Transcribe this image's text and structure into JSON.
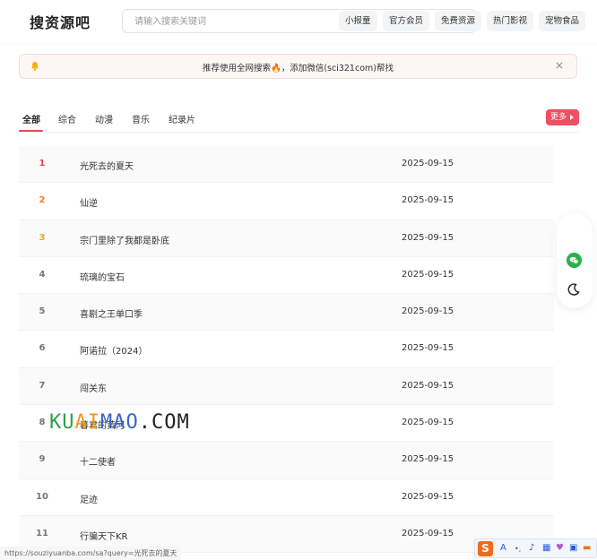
{
  "header": {
    "logo": "搜资源吧",
    "search_placeholder": "请输入搜索关键词",
    "chips": [
      "小报童",
      "官方会员",
      "免费资源",
      "热门影视",
      "宠物食品"
    ]
  },
  "notice": {
    "text": "推荐使用全网搜索🔥，添加微信(sci321com)帮找",
    "close": "×"
  },
  "tabs": {
    "items": [
      "全部",
      "综合",
      "动漫",
      "音乐",
      "纪录片"
    ],
    "active_index": 0,
    "more_label": "更多"
  },
  "list": [
    {
      "rank": "1",
      "title": "光死去的夏天",
      "date": "2025-09-15"
    },
    {
      "rank": "2",
      "title": "仙逆",
      "date": "2025-09-15"
    },
    {
      "rank": "3",
      "title": "宗门里除了我都是卧底",
      "date": "2025-09-15"
    },
    {
      "rank": "4",
      "title": "琉璃的宝石",
      "date": "2025-09-15"
    },
    {
      "rank": "5",
      "title": "喜剧之王单口季",
      "date": "2025-09-15"
    },
    {
      "rank": "6",
      "title": "阿诺拉（2024）",
      "date": "2025-09-15"
    },
    {
      "rank": "7",
      "title": "闯关东",
      "date": "2025-09-15"
    },
    {
      "rank": "8",
      "title": "暮君的黄河",
      "date": "2025-09-15"
    },
    {
      "rank": "9",
      "title": "十二使者",
      "date": "2025-09-15"
    },
    {
      "rank": "10",
      "title": "足迹",
      "date": "2025-09-15"
    },
    {
      "rank": "11",
      "title": "行骗天下KR",
      "date": "2025-09-15"
    }
  ],
  "watermark": {
    "parts": [
      "KU",
      "AI",
      "MAO",
      ".",
      "COM"
    ]
  },
  "status_url": "https://souziyuanba.com/sa?query=光死去的夏天",
  "ime": {
    "logo": "S",
    "a": "A"
  },
  "colors": {
    "accent": "#e5484d",
    "more_button": "#ef4e63",
    "rank1": "#e5484d",
    "rank2": "#f07a24",
    "rank3": "#f0a020",
    "wechat": "#2ab24a"
  },
  "icons": {
    "notice": "bell-icon",
    "close": "close-icon",
    "more": "chevron-right-icon",
    "side_top": "wechat-icon",
    "side_bottom": "moon-icon"
  }
}
